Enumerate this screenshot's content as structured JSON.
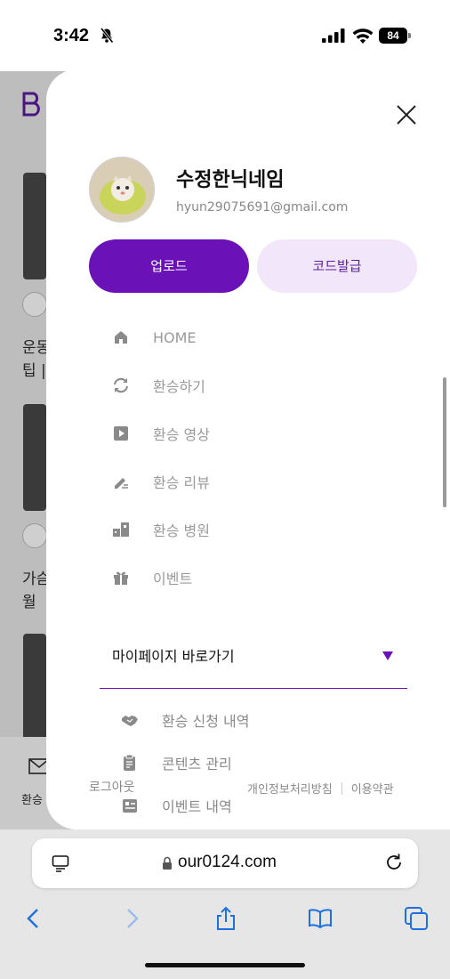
{
  "status_bar": {
    "time": "3:42",
    "battery": "84"
  },
  "background_page": {
    "text_1": "운동",
    "text_2": "팁 |",
    "text_3": "가슴",
    "text_4": "월 ",
    "bottom_label": "환승"
  },
  "drawer": {
    "profile": {
      "nickname": "수정한닉네임",
      "email": "hyun29075691@gmail.com"
    },
    "buttons": {
      "upload": "업로드",
      "code": "코드발급"
    },
    "menu": [
      {
        "label": "HOME",
        "icon": "home-icon"
      },
      {
        "label": "환승하기",
        "icon": "transfer-icon"
      },
      {
        "label": "환승 영상",
        "icon": "play-icon"
      },
      {
        "label": "환승 리뷰",
        "icon": "pen-icon"
      },
      {
        "label": "환승 병원",
        "icon": "building-icon"
      },
      {
        "label": "이벤트",
        "icon": "gift-icon"
      }
    ],
    "mypage": {
      "label": "마이페이지 바로가기"
    },
    "submenu": [
      {
        "label": "환승 신청 내역",
        "icon": "handshake-icon"
      },
      {
        "label": "콘텐츠 관리",
        "icon": "clipboard-icon"
      },
      {
        "label": "이벤트 내역",
        "icon": "event-icon"
      }
    ],
    "footer": {
      "logout": "로그아웃",
      "privacy": "개인정보처리방침",
      "terms": "이용약관"
    }
  },
  "browser": {
    "url": "our0124.com"
  },
  "colors": {
    "accent": "#6a11b7",
    "accent_light": "#f1e6fa"
  }
}
